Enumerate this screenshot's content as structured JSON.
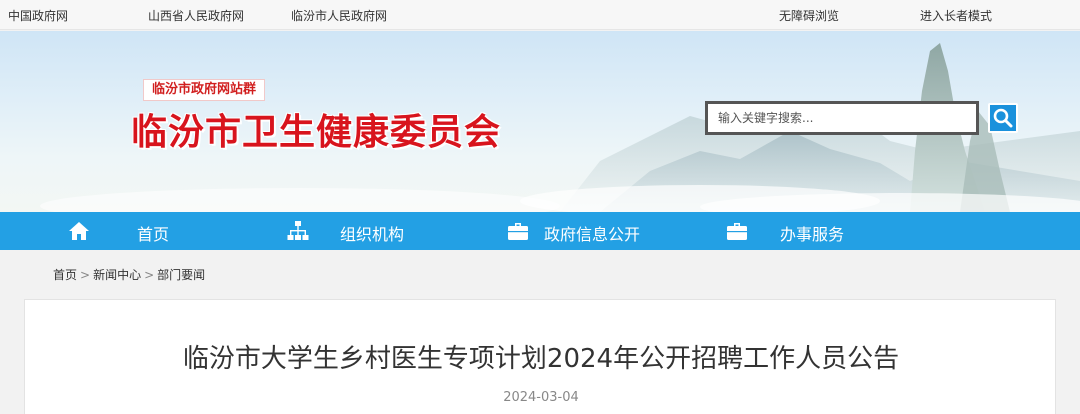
{
  "topbar": {
    "links_left": [
      "中国政府网",
      "山西省人民政府网",
      "临汾市人民政府网"
    ],
    "links_right": [
      "无障碍浏览",
      "进入长者模式"
    ]
  },
  "banner": {
    "site_group": "临汾市政府网站群",
    "site_title": "临汾市卫生健康委员会",
    "search": {
      "placeholder": "输入关键字搜索...",
      "button_icon": "search-icon"
    }
  },
  "nav": {
    "items": [
      {
        "label": "首页",
        "icon": "home-icon"
      },
      {
        "label": "组织机构",
        "icon": "org-chart-icon"
      },
      {
        "label": "政府信息公开",
        "icon": "briefcase-icon"
      },
      {
        "label": "办事服务",
        "icon": "briefcase-icon"
      }
    ]
  },
  "breadcrumb": {
    "items": [
      "首页",
      "新闻中心",
      "部门要闻"
    ],
    "separator": ">"
  },
  "article": {
    "title": "临汾市大学生乡村医生专项计划2024年公开招聘工作人员公告",
    "date": "2024-03-04"
  },
  "colors": {
    "nav_bg": "#23a0e4",
    "title_red": "#d8141d",
    "search_button": "#1a91dc"
  }
}
